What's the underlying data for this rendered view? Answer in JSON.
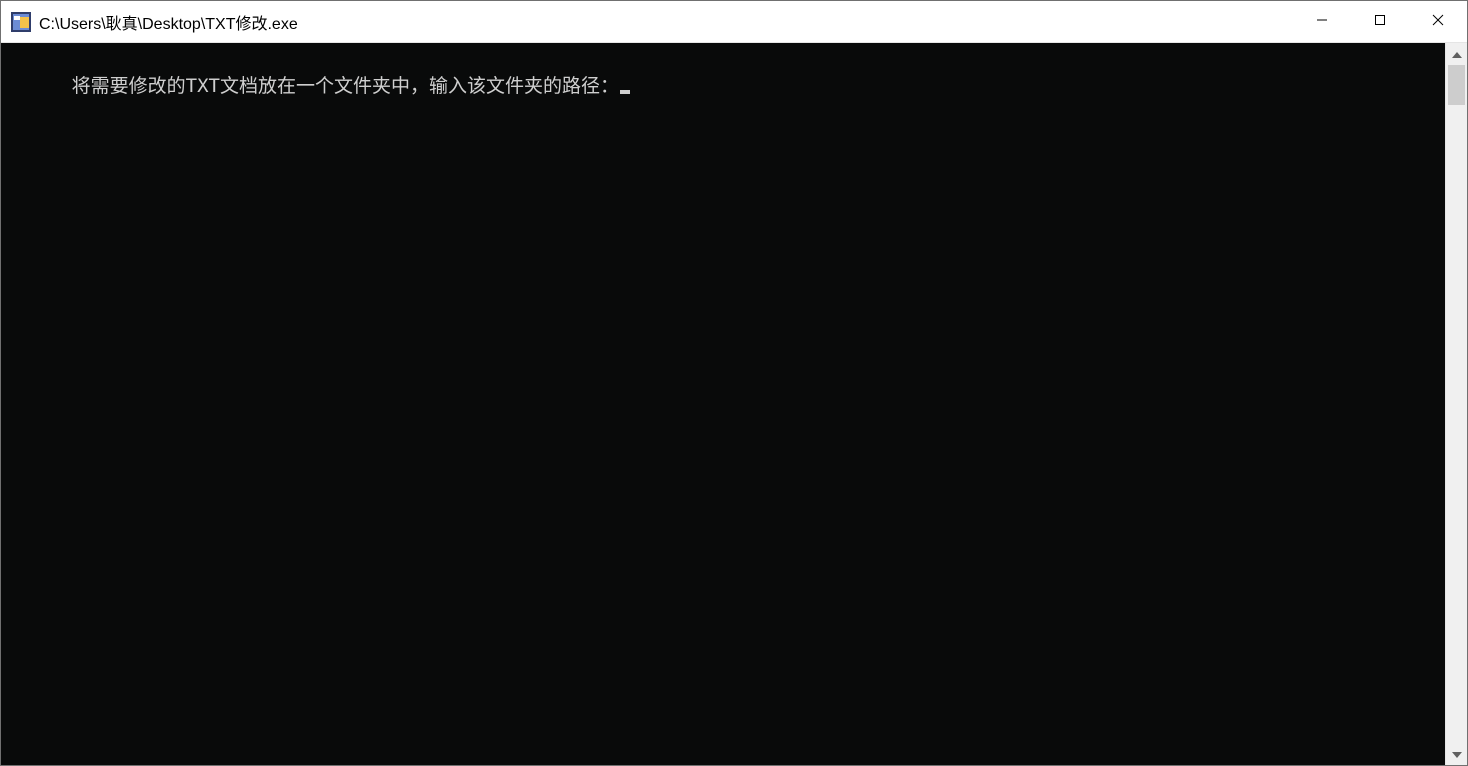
{
  "window": {
    "title": "C:\\Users\\耿真\\Desktop\\TXT修改.exe"
  },
  "console": {
    "prompt": "将需要修改的TXT文档放在一个文件夹中，输入该文件夹的路径："
  },
  "icons": {
    "app": "app-icon",
    "minimize": "minimize-icon",
    "maximize": "maximize-icon",
    "close": "close-icon",
    "scroll_up": "scroll-up-icon",
    "scroll_down": "scroll-down-icon"
  },
  "colors": {
    "console_bg": "#090a0a",
    "console_fg": "#cfcfcf",
    "title_fg": "#000000",
    "scrollbar_track": "#f0f0f0",
    "scrollbar_thumb": "#cdcdcd"
  }
}
